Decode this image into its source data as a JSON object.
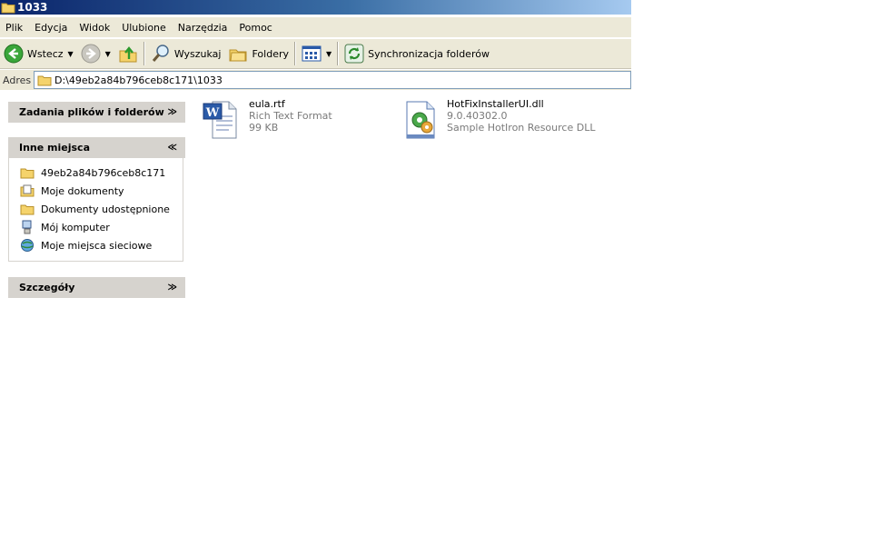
{
  "window": {
    "title": "1033"
  },
  "menu": [
    "Plik",
    "Edycja",
    "Widok",
    "Ulubione",
    "Narzędzia",
    "Pomoc"
  ],
  "toolbar": {
    "back_label": "Wstecz",
    "search_label": "Wyszukaj",
    "folders_label": "Foldery",
    "sync_label": "Synchronizacja folderów"
  },
  "address": {
    "label": "Adres",
    "path": "D:\\49eb2a84b796ceb8c171\\1033"
  },
  "tasks": {
    "file_tasks_title": "Zadania plików i folderów",
    "other_places_title": "Inne miejsca",
    "details_title": "Szczegóły",
    "places": [
      {
        "label": "49eb2a84b796ceb8c171",
        "icon": "folder-icon"
      },
      {
        "label": "Moje dokumenty",
        "icon": "my-documents-icon"
      },
      {
        "label": "Dokumenty udostępnione",
        "icon": "shared-folder-icon"
      },
      {
        "label": "Mój komputer",
        "icon": "computer-icon"
      },
      {
        "label": "Moje miejsca sieciowe",
        "icon": "network-places-icon"
      }
    ]
  },
  "files": [
    {
      "name": "eula.rtf",
      "line2": "Rich Text Format",
      "line3": "99 KB",
      "icon": "word-document-icon"
    },
    {
      "name": "HotFixInstallerUI.dll",
      "line2": "9.0.40302.0",
      "line3": "Sample HotIron Resource DLL",
      "icon": "dll-gear-icon"
    }
  ]
}
